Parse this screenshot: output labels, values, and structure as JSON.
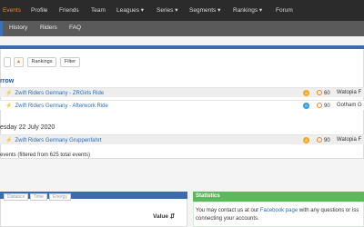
{
  "topnav": {
    "items": [
      {
        "label": "Events",
        "active": true
      },
      {
        "label": "Profile"
      },
      {
        "label": "Friends"
      },
      {
        "label": "Team"
      },
      {
        "label": "Leagues ▾"
      },
      {
        "label": "Series ▾"
      },
      {
        "label": "Segments ▾"
      },
      {
        "label": "Rankings ▾"
      },
      {
        "label": "Forum"
      }
    ]
  },
  "subnav": {
    "items": [
      {
        "label": "History"
      },
      {
        "label": "Riders"
      },
      {
        "label": "FAQ"
      }
    ]
  },
  "toolbar": {
    "rankings_label": "Rankings",
    "filter_label": "Filter"
  },
  "sections": [
    {
      "heading": "rrow",
      "events": [
        {
          "name": "Zwift Riders Germany - ZRGirls Ride",
          "badge": "a",
          "badge_color": "#f5a623",
          "points": "60",
          "route": "Watopia F"
        },
        {
          "name": "Zwift Riders Germany - Afterwork Ride",
          "badge": "e",
          "badge_color": "#2a9fd6",
          "points": "90",
          "route": "Gotham G"
        }
      ]
    },
    {
      "heading": "esday 22 July 2020",
      "events": [
        {
          "name": "Zwift Riders Germany Gruppenfahrt",
          "badge": "a",
          "badge_color": "#f5a623",
          "points": "90",
          "route": "Watopia F"
        }
      ]
    }
  ],
  "summary": "events (filtered from 625 total events)",
  "bottom_tabs": [
    {
      "label": "Distance"
    },
    {
      "label": "Time"
    },
    {
      "label": "Energy"
    }
  ],
  "value_label": "Value ⇵",
  "statistics": {
    "title": "Statistics",
    "text_before": "You may contact us at our ",
    "link": "Facebook page",
    "text_after": " with any questions or iss",
    "line2": "connecting your accounts."
  },
  "colors": {
    "accent": "#f5821f",
    "link": "#2a6db8",
    "brand_blue": "#3b6cb0",
    "stats_green": "#5cb85c"
  }
}
